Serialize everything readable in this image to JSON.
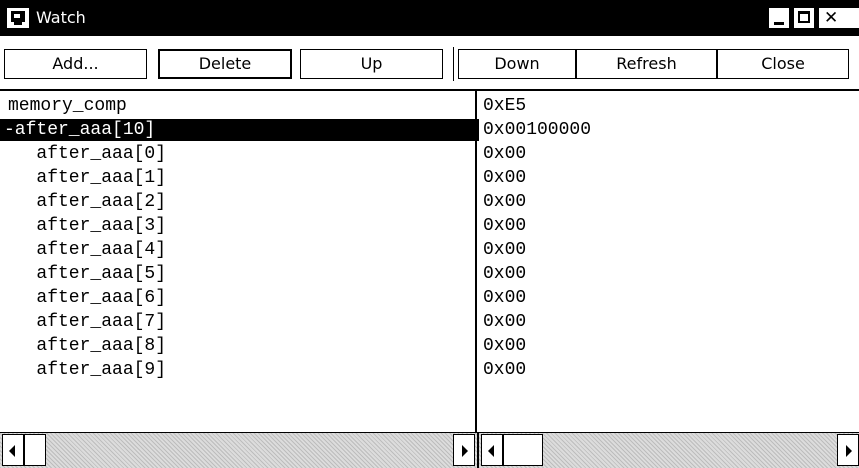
{
  "window": {
    "title": "Watch",
    "icon": "watch-window-icon"
  },
  "toolbar": {
    "buttons": [
      {
        "label": "Add..."
      },
      {
        "label": "Delete"
      },
      {
        "label": "Up"
      },
      {
        "label": "Down"
      },
      {
        "label": "Refresh"
      },
      {
        "label": "Close"
      }
    ]
  },
  "watch": {
    "names": [
      {
        "text": "memory_comp"
      },
      {
        "text": "-after_aaa[10]",
        "selected": true
      },
      {
        "text": "   after_aaa[0]"
      },
      {
        "text": "   after_aaa[1]"
      },
      {
        "text": "   after_aaa[2]"
      },
      {
        "text": "   after_aaa[3]"
      },
      {
        "text": "   after_aaa[4]"
      },
      {
        "text": "   after_aaa[5]"
      },
      {
        "text": "   after_aaa[6]"
      },
      {
        "text": "   after_aaa[7]"
      },
      {
        "text": "   after_aaa[8]"
      },
      {
        "text": "   after_aaa[9]"
      }
    ],
    "values": [
      "0xE5",
      "0x00100000",
      "0x00",
      "0x00",
      "0x00",
      "0x00",
      "0x00",
      "0x00",
      "0x00",
      "0x00",
      "0x00",
      "0x00"
    ]
  }
}
